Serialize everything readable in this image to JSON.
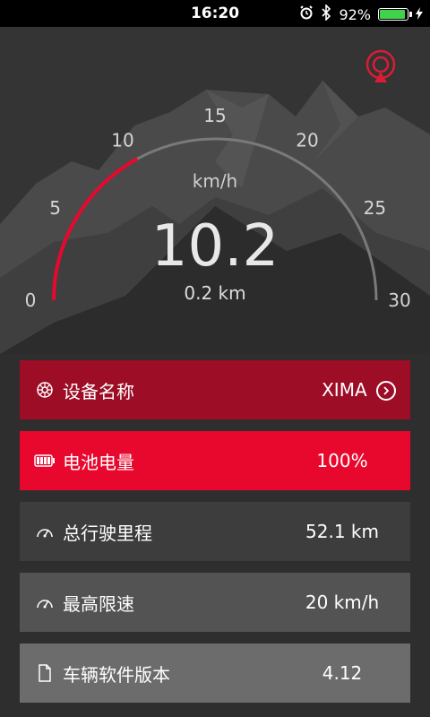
{
  "status": {
    "time": "16:20",
    "battery_percent": "92%",
    "battery_level": 0.92,
    "icons": [
      "alarm-icon",
      "bluetooth-icon",
      "battery-icon",
      "charging-icon"
    ]
  },
  "speedometer": {
    "unit": "km/h",
    "speed": "10.2",
    "distance": "0.2 km",
    "ticks": [
      "0",
      "5",
      "10",
      "15",
      "20",
      "25",
      "30"
    ],
    "max": 30,
    "current_value": 10.2,
    "arc_color": "#e8082e"
  },
  "rows": [
    {
      "icon": "settings-wheel-icon",
      "label": "设备名称",
      "value": "XIMA",
      "color": "#9d0d25"
    },
    {
      "icon": "battery-icon",
      "label": "电池电量",
      "value": "100%",
      "color": "#e8082e"
    },
    {
      "icon": "speedometer-icon",
      "label": "总行驶里程",
      "value": "52.1 km",
      "color": "#3d3d3d"
    },
    {
      "icon": "speedometer-icon",
      "label": "最高限速",
      "value": "20 km/h",
      "color": "#535353"
    },
    {
      "icon": "document-icon",
      "label": "车辆软件版本",
      "value": "4.12",
      "color": "#6c6c6c"
    }
  ]
}
